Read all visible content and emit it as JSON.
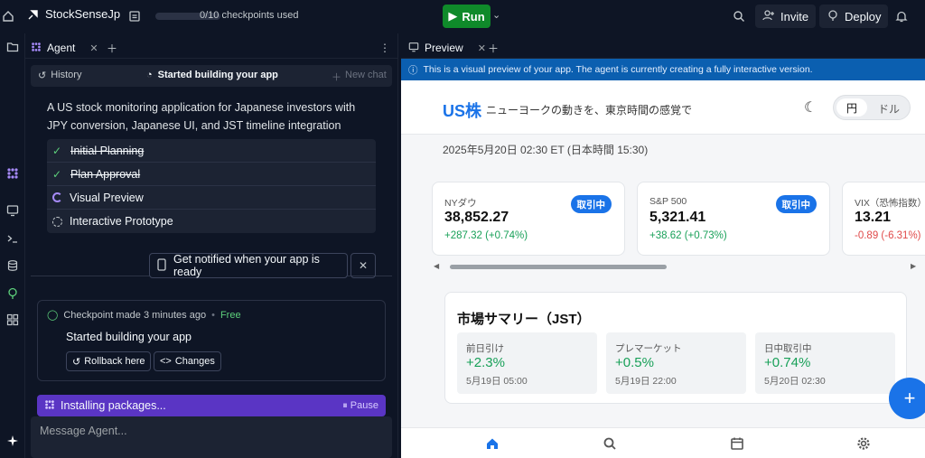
{
  "topbar": {
    "project_name": "StockSenseJp",
    "checkpoints": "0/10 checkpoints used",
    "run_label": "Run",
    "invite_label": "Invite",
    "deploy_label": "Deploy"
  },
  "agent": {
    "tab_label": "Agent",
    "history_label": "History",
    "status_title": "Started building your app",
    "new_chat_label": "New chat",
    "intro": "A US stock monitoring application for Japanese investors with JPY conversion, Japanese UI, and JST timeline integration",
    "steps": [
      {
        "label": "Initial Planning",
        "state": "done"
      },
      {
        "label": "Plan Approval",
        "state": "done"
      },
      {
        "label": "Visual Preview",
        "state": "in-progress"
      },
      {
        "label": "Interactive Prototype",
        "state": "pending"
      }
    ],
    "notify_label": "Get notified when your app is ready",
    "checkpoint": {
      "meta": "Checkpoint made 3 minutes ago",
      "free": "Free",
      "title": "Started building your app",
      "rollback_label": "Rollback here",
      "changes_label": "Changes"
    },
    "installing_label": "Installing packages...",
    "pause_label": "Pause",
    "message_placeholder": "Message Agent..."
  },
  "preview": {
    "tab_label": "Preview",
    "banner": "This is a visual preview of your app. The agent is currently creating a fully interactive version.",
    "app": {
      "brand": "US株",
      "tagline": "ニューヨークの動きを、東京時間の感覚で",
      "currency_a": "円",
      "currency_b": "ドル",
      "datetime": "2025年5月20日 02:30 ET (日本時間 15:30)",
      "live_label": "取引中",
      "cards": [
        {
          "name": "NYダウ",
          "value": "38,852.27",
          "change": "+287.32 (+0.74%)",
          "direction": "up"
        },
        {
          "name": "S&P 500",
          "value": "5,321.41",
          "change": "+38.62 (+0.73%)",
          "direction": "up"
        },
        {
          "name": "VIX（恐怖指数）",
          "value": "13.21",
          "change": "-0.89 (-6.31%)",
          "direction": "down"
        }
      ],
      "summary": {
        "title": "市場サマリー（JST）",
        "items": [
          {
            "label": "前日引け",
            "value": "+2.3%",
            "time": "5月19日 05:00"
          },
          {
            "label": "プレマーケット",
            "value": "+0.5%",
            "time": "5月19日 22:00"
          },
          {
            "label": "日中取引中",
            "value": "+0.74%",
            "time": "5月20日 02:30"
          }
        ]
      }
    }
  },
  "colors": {
    "accent": "#1a73e8",
    "positive": "#18a058",
    "negative": "#e04a4a",
    "run": "#0f8a2a",
    "installing": "#5a35c4"
  }
}
